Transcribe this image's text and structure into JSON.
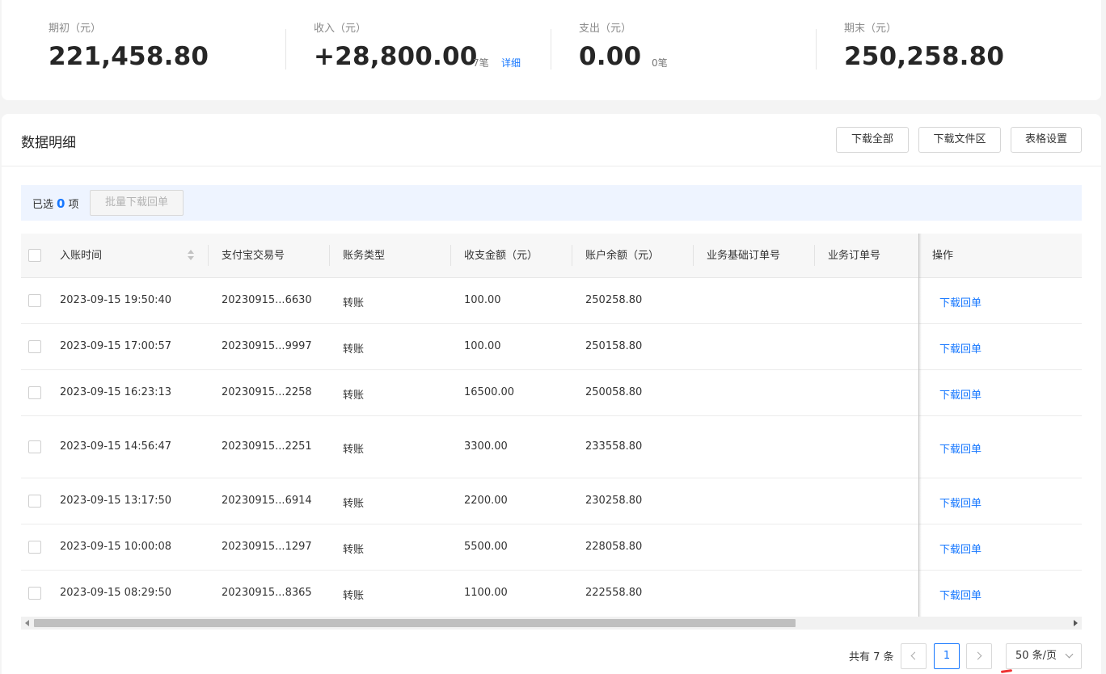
{
  "summary": [
    {
      "label": "期初（元）",
      "value": "221,458.80"
    },
    {
      "label": "收入（元）",
      "value": "+28,800.00",
      "count": "7笔",
      "detail": "详细"
    },
    {
      "label": "支出（元）",
      "value": "0.00",
      "count": "0笔"
    },
    {
      "label": "期末（元）",
      "value": "250,258.80"
    }
  ],
  "detail": {
    "title": "数据明细",
    "buttons": {
      "download_all": "下载全部",
      "download_area": "下载文件区",
      "table_settings": "表格设置"
    },
    "selection": {
      "prefix": "已选",
      "count": "0",
      "suffix": "项",
      "batch": "批量下载回单"
    }
  },
  "table": {
    "headers": [
      "入账时间",
      "支付宝交易号",
      "账务类型",
      "收支金额（元）",
      "账户余额（元）",
      "业务基础订单号",
      "业务订单号",
      "操作"
    ],
    "rows": [
      {
        "time": "2023-09-15 19:50:40",
        "trade_no": "20230915...6630",
        "type": "转账",
        "amount": "100.00",
        "balance": "250258.80",
        "base_order": "",
        "order": "",
        "action": "下载回单"
      },
      {
        "time": "2023-09-15 17:00:57",
        "trade_no": "20230915...9997",
        "type": "转账",
        "amount": "100.00",
        "balance": "250158.80",
        "base_order": "",
        "order": "",
        "action": "下载回单"
      },
      {
        "time": "2023-09-15 16:23:13",
        "trade_no": "20230915...2258",
        "type": "转账",
        "amount": "16500.00",
        "balance": "250058.80",
        "base_order": "",
        "order": "",
        "action": "下载回单"
      },
      {
        "time": "2023-09-15 14:56:47",
        "trade_no": "20230915...2251",
        "type": "转账",
        "amount": "3300.00",
        "balance": "233558.80",
        "base_order": "",
        "order": "",
        "action": "下载回单"
      },
      {
        "time": "2023-09-15 13:17:50",
        "trade_no": "20230915...6914",
        "type": "转账",
        "amount": "2200.00",
        "balance": "230258.80",
        "base_order": "",
        "order": "",
        "action": "下载回单"
      },
      {
        "time": "2023-09-15 10:00:08",
        "trade_no": "20230915...1297",
        "type": "转账",
        "amount": "5500.00",
        "balance": "228058.80",
        "base_order": "",
        "order": "",
        "action": "下载回单"
      },
      {
        "time": "2023-09-15 08:29:50",
        "trade_no": "20230915...8365",
        "type": "转账",
        "amount": "1100.00",
        "balance": "222558.80",
        "base_order": "",
        "order": "",
        "action": "下载回单"
      }
    ]
  },
  "pagination": {
    "total": "共有 7 条",
    "current": "1",
    "page_size": "50 条/页"
  },
  "colors": {
    "accent": "#1677ff",
    "selection_bg": "#eef4ff",
    "page_bg": "#f4f4f4"
  }
}
